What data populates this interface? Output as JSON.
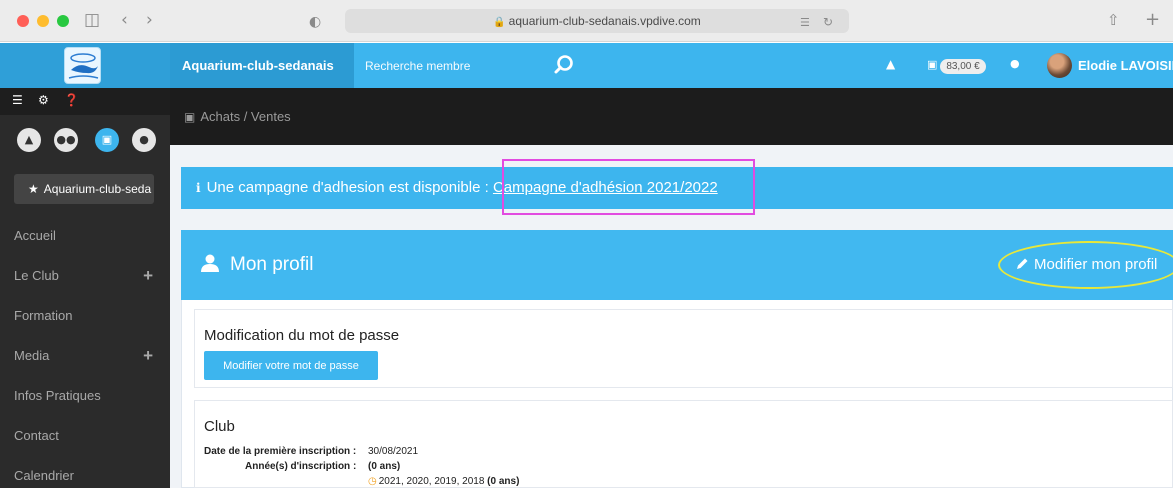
{
  "browser": {
    "url": "aquarium-club-sedanais.vpdive.com",
    "lock_icon": "lock-icon"
  },
  "navbar": {
    "brand": "Aquarium-club-sedanais",
    "search_placeholder": "Recherche membre",
    "cart_amount": "83,00 €",
    "user_name": "Elodie LAVOISIER",
    "colors": {
      "primary": "#3db5ee",
      "brand_bg": "#2c9bd3"
    }
  },
  "sidebar": {
    "club_button": "Aquarium-club-seda",
    "items": [
      {
        "label": "Accueil",
        "expandable": false
      },
      {
        "label": "Le Club",
        "expandable": true
      },
      {
        "label": "Formation",
        "expandable": false
      },
      {
        "label": "Media",
        "expandable": true
      },
      {
        "label": "Infos Pratiques",
        "expandable": false
      },
      {
        "label": "Contact",
        "expandable": false
      },
      {
        "label": "Calendrier",
        "expandable": false
      }
    ],
    "plus_symbol": "+"
  },
  "breadcrumb": "Achats / Ventes",
  "alert": {
    "text": "Une campagne d'adhesion est disponible :",
    "link": "Campagne d'adhésion 2021/2022"
  },
  "profile": {
    "title": "Mon profil",
    "modify_link": "Modifier mon profil",
    "password_section": {
      "title": "Modification du mot de passe",
      "button": "Modifier votre mot de passe"
    },
    "club_section": {
      "title": "Club",
      "first_registration_label": "Date de la première inscription :",
      "first_registration_value": "30/08/2021",
      "years_label": "Année(s) d'inscription :",
      "years_value": "(0 ans)",
      "years_list": "2021, 2020, 2019, 2018",
      "years_list_suffix": "(0 ans)"
    }
  }
}
